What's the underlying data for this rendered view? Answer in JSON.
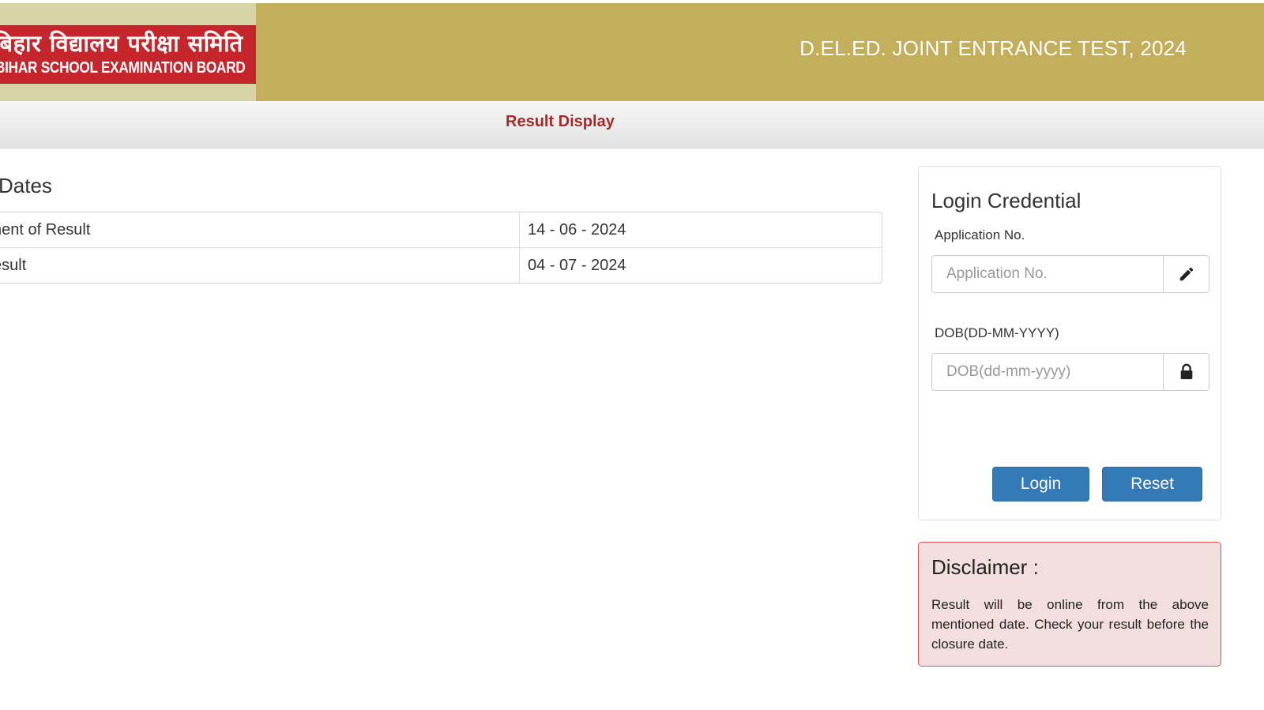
{
  "header": {
    "logo_hindi": "बिहार विद्यालय परीक्षा समिति",
    "logo_english": "BIHAR SCHOOL EXAMINATION BOARD",
    "title": "D.EL.ED. JOINT ENTRANCE TEST, 2024"
  },
  "nav": {
    "result_display": "Result Display"
  },
  "dates": {
    "heading": "Dates",
    "rows": [
      {
        "label": "nent of Result",
        "value": "14 - 06 - 2024"
      },
      {
        "label": "esult",
        "value": "04 - 07 - 2024"
      }
    ]
  },
  "login": {
    "title": "Login Credential",
    "application_label": "Application No.",
    "application_placeholder": "Application No.",
    "application_icon": "pencil-icon",
    "dob_label": "DOB(DD-MM-YYYY)",
    "dob_placeholder": "DOB(dd-mm-yyyy)",
    "dob_icon": "lock-icon",
    "login_button": "Login",
    "reset_button": "Reset"
  },
  "disclaimer": {
    "title": "Disclaimer :",
    "text": "Result will be online from the above mentioned date. Check your result before the closure date."
  },
  "colors": {
    "header_bg": "#c2ae5b",
    "logo_red": "#c4262b",
    "nav_link": "#a52a2a",
    "button": "#337ab7",
    "disclaimer_bg": "#f2dede",
    "disclaimer_border": "#d9534f"
  }
}
